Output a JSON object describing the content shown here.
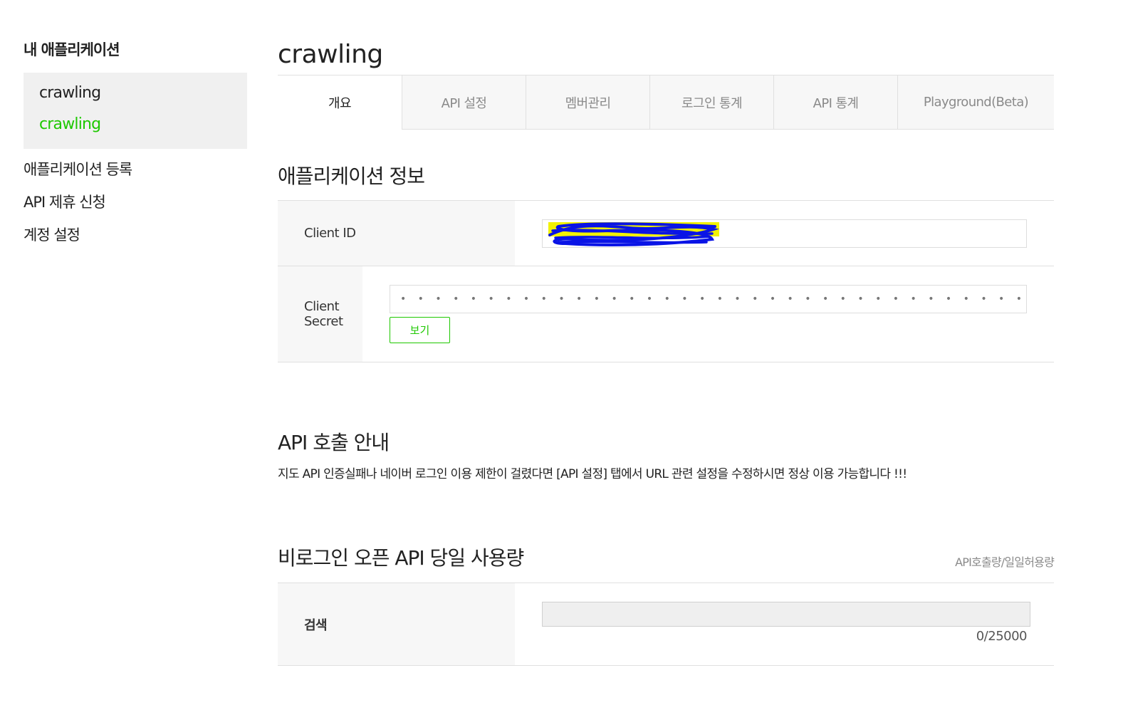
{
  "sidebar": {
    "title": "내 애플리케이션",
    "apps": [
      "crawling",
      "crawling"
    ],
    "links": [
      "애플리케이션 등록",
      "API 제휴 신청",
      "계정 설정"
    ]
  },
  "main": {
    "title": "crawling",
    "tabs": [
      "개요",
      "API 설정",
      "멤버관리",
      "로그인 통계",
      "API 통계",
      "Playground(Beta)"
    ]
  },
  "app_info": {
    "title": "애플리케이션 정보",
    "client_id_label": "Client ID",
    "client_secret_label": "Client Secret",
    "client_secret_value": "• • • • • • • • • • • • • • • • • • • • • • • • • • • • • • • • • • • •",
    "view_button": "보기"
  },
  "api_guide": {
    "title": "API 호출 안내",
    "description": "지도 API 인증실패나 네이버 로그인 이용 제한이 걸렸다면 [API 설정] 탭에서 URL 관련 설정을 수정하시면 정상 이용 가능합니다 !!!"
  },
  "usage": {
    "title": "비로그인 오픈 API 당일 사용량",
    "unit": "API호출량/일일허용량",
    "rows": [
      {
        "label": "검색",
        "count": "0/25000",
        "fraction": 0
      }
    ]
  },
  "colors": {
    "accent": "#1ec800",
    "redaction_blue": "#0a14e6",
    "redaction_yellow": "#f2f200"
  }
}
